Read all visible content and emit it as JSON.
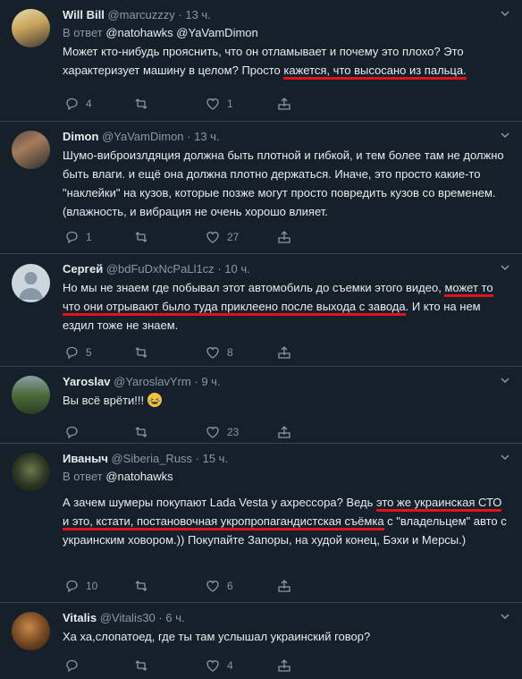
{
  "tweets": [
    {
      "name": "Will Bill",
      "handle": "@marcuzzzy",
      "time": "· 13 ч.",
      "reply_prefix": "В ответ",
      "reply_to": "@natohawks @YaVamDimon",
      "text_parts": [
        "Может кто-нибудь прояснить, что он отламывает и почему это плохо? Это характеризует машину в целом? Просто ",
        "кажется, что высосано из пальца."
      ],
      "replies": "4",
      "retweets": "",
      "likes": "1"
    },
    {
      "name": "Dimon",
      "handle": "@YaVamDimon",
      "time": "· 13 ч.",
      "text": "Шумо-виброизлдяция должна быть плотной и гибкой, и тем более там не должно быть влаги. и ещё она должна плотно держаться. Иначе, это просто какие-то \"наклейки\" на кузов, которые позже могут просто повредить кузов со временем. (влажность, и вибрация не очень хорошо влияет.",
      "replies": "1",
      "retweets": "",
      "likes": "27"
    },
    {
      "name": "Сергей",
      "handle": "@bdFuDxNcPaLl1cz",
      "time": "· 10 ч.",
      "text_parts": [
        "Но мы не знаем где побывал этот автомобиль до съемки этого видео, ",
        "может то что они отрывают было туда приклеено после выхода с завода",
        ". И кто на нем ездил тоже не знаем."
      ],
      "replies": "5",
      "retweets": "",
      "likes": "8"
    },
    {
      "name": "Yaroslav",
      "handle": "@YaroslavYrm",
      "time": "· 9 ч.",
      "text": "Вы всё врёти!!!",
      "replies": "",
      "retweets": "",
      "likes": "23"
    },
    {
      "name": "Иваныч",
      "handle": "@Siberia_Russ",
      "time": "· 15 ч.",
      "reply_prefix": "В ответ",
      "reply_to": "@natohawks",
      "text_parts": [
        "А зачем шумеры покупают Lada Vesta у ахрессора? Ведь ",
        "это же украинская СТО и это, кстати, постановочная укропропагандистская съёмка",
        " с \"владельцем\" авто с украинским ховором.)) Покупайте Запоры, на худой конец, Бэхи и Мерсы.)"
      ],
      "replies": "10",
      "retweets": "",
      "likes": "6"
    },
    {
      "name": "Vitalis",
      "handle": "@Vitalis30",
      "time": "· 6 ч.",
      "text": "Ха ха,слопатоед, где ты там услышал украинский говор?",
      "replies": "",
      "retweets": "",
      "likes": "4"
    }
  ],
  "colors": {
    "background": "#15202b",
    "muted": "#8899a6",
    "text": "#e6ecf0",
    "underline": "#e0121b"
  }
}
